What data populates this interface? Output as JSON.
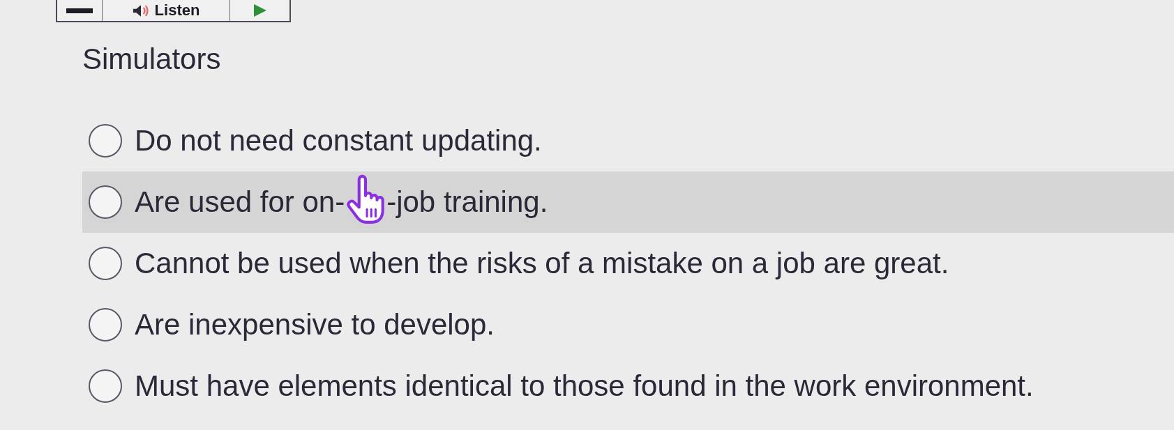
{
  "toolbar": {
    "buttons": [
      {
        "kind": "minus"
      },
      {
        "kind": "listen",
        "label": "Listen"
      },
      {
        "kind": "play"
      }
    ]
  },
  "question": {
    "title": "Simulators"
  },
  "options": [
    {
      "text_parts": [
        "Do not need constant updating."
      ],
      "selected": false,
      "hovered": false
    },
    {
      "text_parts": [
        "Are used for on-",
        "-job training."
      ],
      "selected": false,
      "hovered": true
    },
    {
      "text_parts": [
        "Cannot be used when the risks of a mistake on a job are great."
      ],
      "selected": false,
      "hovered": false
    },
    {
      "text_parts": [
        "Are inexpensive to develop."
      ],
      "selected": false,
      "hovered": false
    },
    {
      "text_parts": [
        "Must have elements identical to those found in the work environment."
      ],
      "selected": false,
      "hovered": false
    }
  ]
}
